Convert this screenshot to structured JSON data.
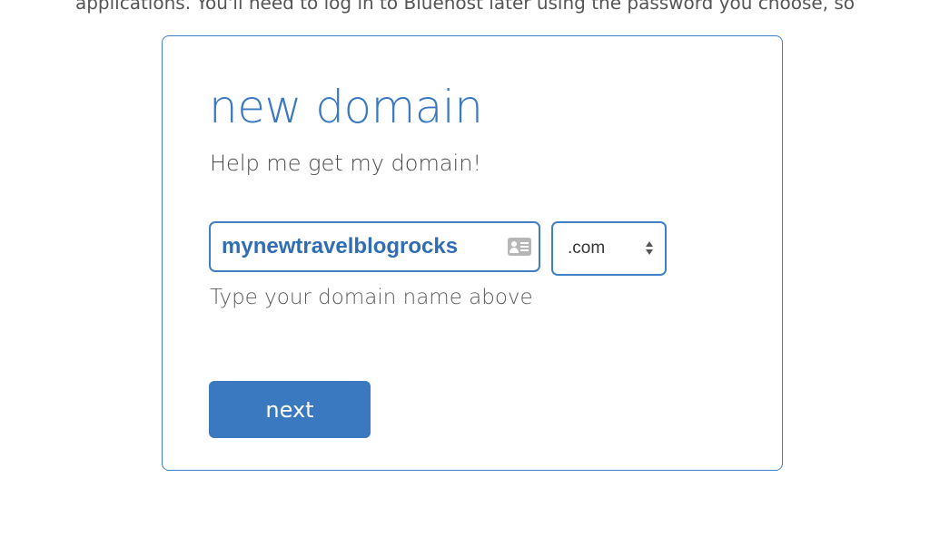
{
  "top_fragment": "applications. You'll need to log in to Bluehost later using the password you choose, so",
  "card": {
    "title": "new domain",
    "subtitle": "Help me get my domain!",
    "domain_input": {
      "value": "mynewtravelblogrocks",
      "icon": "contact-card-icon"
    },
    "tld_select": {
      "selected": ".com",
      "icon": "select-arrows-icon"
    },
    "hint": "Type your domain name above",
    "next_label": "next"
  },
  "colors": {
    "accent": "#3a78c0",
    "border": "#3f7fc5",
    "text": "#4a4a4a"
  }
}
